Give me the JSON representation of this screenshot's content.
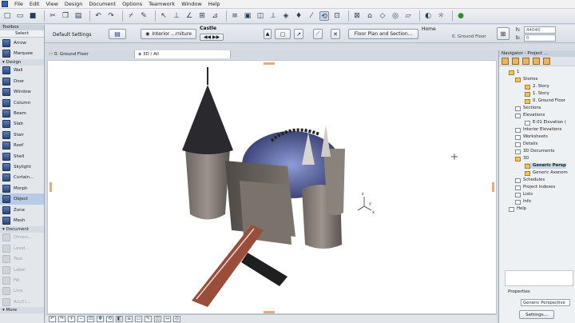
{
  "menu": [
    "File",
    "Edit",
    "View",
    "Design",
    "Document",
    "Options",
    "Teamwork",
    "Window",
    "Help"
  ],
  "infobox": {
    "default_settings": "Default Settings",
    "favorite": "Interior ...rniture",
    "object_name": "Castle",
    "section_button": "Floor Plan and Section...",
    "home": "Home",
    "home_value": "0. Ground Floor",
    "field_a": "44040",
    "field_b": "0"
  },
  "toolbox": {
    "title": "Toolbox",
    "select": "Select",
    "groups": {
      "design": "Design",
      "document": "Document",
      "more": "More"
    },
    "items_top": [
      "Arrow",
      "Marquee"
    ],
    "design_items": [
      "Wall",
      "Door",
      "Window",
      "Column",
      "Beam",
      "Slab",
      "Stair",
      "Roof",
      "Shell",
      "Skylight",
      "Curtain...",
      "Morph",
      "Object",
      "Zone",
      "Mesh"
    ],
    "document_items": [
      "Dimen...",
      "Level...",
      "Text",
      "Label",
      "Fill",
      "Line",
      "Arc/Ci..."
    ]
  },
  "tabs": [
    "0. Ground Floor",
    "3D / All"
  ],
  "navigator": {
    "title": "Navigator - Project ...",
    "tree": {
      "root": "1",
      "stories": "Stories",
      "story2": "2. Story",
      "story1": "1. Story",
      "story0": "0. Ground Floor",
      "sections": "Sections",
      "elevations": "Elevations",
      "elev1": "E-01 Elevation (",
      "interior": "Interior Elevations",
      "worksheets": "Worksheets",
      "details": "Details",
      "docs3d": "3D Documents",
      "node3d": "3D",
      "persp": "Generic Persp",
      "axon": "Generic Axonom",
      "schedules": "Schedules",
      "indexes": "Project Indexes",
      "lists": "Lists",
      "info": "Info",
      "help": "Help"
    },
    "properties_label": "Properties",
    "properties_value": "Generic Perspective",
    "settings_button": "Settings..."
  },
  "colors": {
    "accent_blue": "#2b4877",
    "folder": "#f2c266"
  }
}
